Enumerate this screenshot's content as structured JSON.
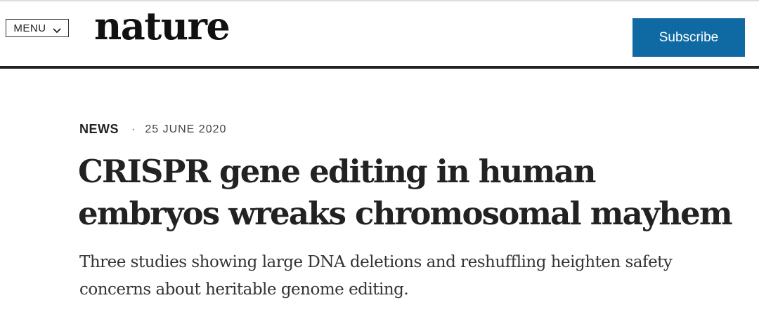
{
  "header": {
    "menu_label": "MENU",
    "menu_icon": "chevron-down-icon",
    "logo_text": "nature",
    "subscribe_label": "Subscribe"
  },
  "article": {
    "type": "NEWS",
    "separator": "·",
    "date": "25 JUNE 2020",
    "title": "CRISPR gene editing in human embryos wreaks chromosomal mayhem",
    "standfirst": "Three studies showing large DNA deletions and reshuffling heighten safety concerns about heritable genome editing."
  },
  "colors": {
    "accent": "#0f6aa3",
    "text": "#222222",
    "rule": "#222222"
  }
}
